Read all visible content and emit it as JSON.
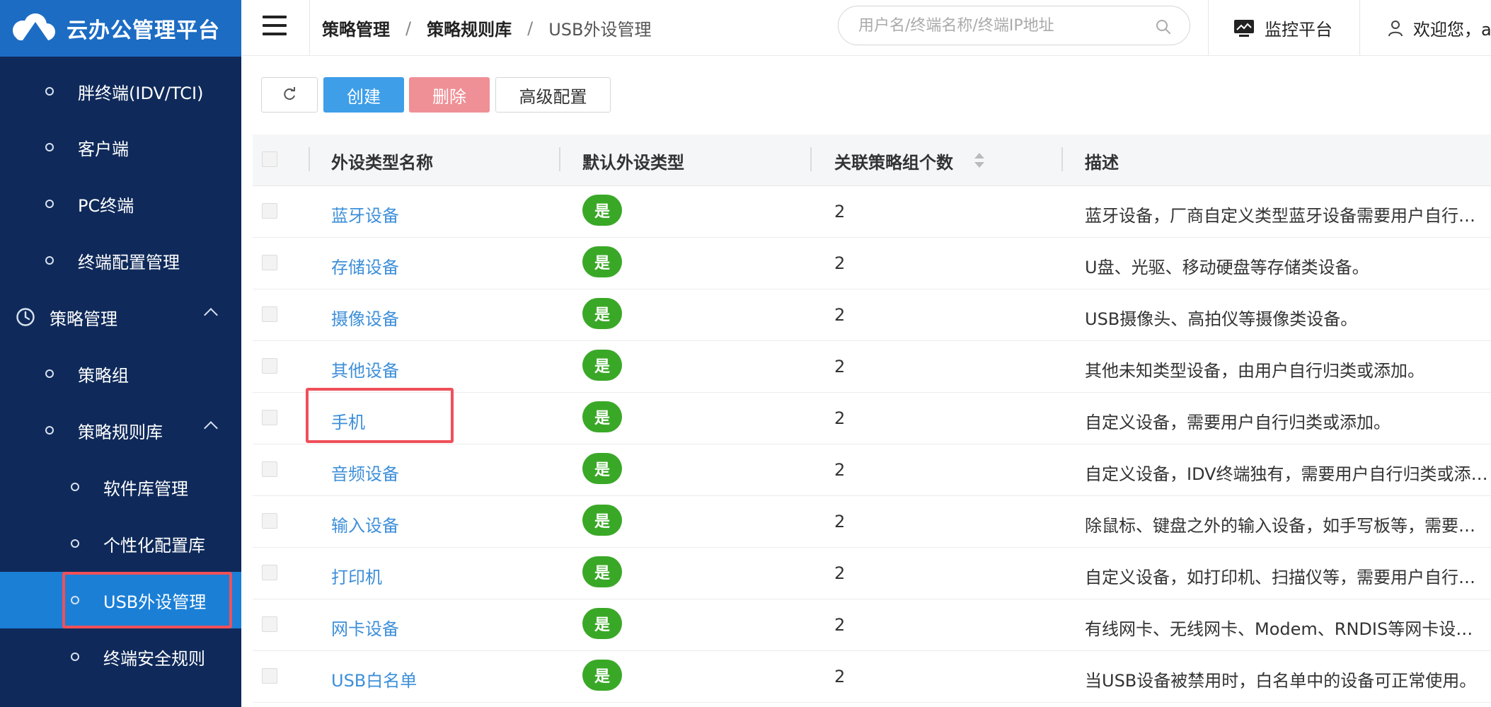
{
  "brand": {
    "name": "云办公管理平台"
  },
  "sidebar": {
    "items": [
      {
        "label": "胖终端(IDV/TCI)"
      },
      {
        "label": "客户端"
      },
      {
        "label": "PC终端"
      },
      {
        "label": "终端配置管理"
      },
      {
        "label": "策略管理"
      },
      {
        "label": "策略组"
      },
      {
        "label": "策略规则库"
      },
      {
        "label": "软件库管理"
      },
      {
        "label": "个性化配置库"
      },
      {
        "label": "USB外设管理"
      },
      {
        "label": "终端安全规则"
      }
    ]
  },
  "header": {
    "breadcrumb": [
      "策略管理",
      "策略规则库",
      "USB外设管理"
    ],
    "search_placeholder": "用户名/终端名称/终端IP地址",
    "monitor_label": "监控平台",
    "welcome_label": "欢迎您，a"
  },
  "toolbar": {
    "create_label": "创建",
    "delete_label": "删除",
    "advanced_label": "高级配置"
  },
  "table": {
    "columns": [
      "外设类型名称",
      "默认外设类型",
      "关联策略组个数",
      "描述"
    ],
    "rows": [
      {
        "name": "蓝牙设备",
        "default": "是",
        "count": "2",
        "desc": "蓝牙设备，厂商自定义类型蓝牙设备需要用户自行归类或添加。"
      },
      {
        "name": "存储设备",
        "default": "是",
        "count": "2",
        "desc": "U盘、光驱、移动硬盘等存储类设备。"
      },
      {
        "name": "摄像设备",
        "default": "是",
        "count": "2",
        "desc": "USB摄像头、高拍仪等摄像类设备。"
      },
      {
        "name": "其他设备",
        "default": "是",
        "count": "2",
        "desc": "其他未知类型设备，由用户自行归类或添加。"
      },
      {
        "name": "手机",
        "default": "是",
        "count": "2",
        "desc": "自定义设备，需要用户自行归类或添加。"
      },
      {
        "name": "音频设备",
        "default": "是",
        "count": "2",
        "desc": "自定义设备，IDV终端独有，需要用户自行归类或添加。"
      },
      {
        "name": "输入设备",
        "default": "是",
        "count": "2",
        "desc": "除鼠标、键盘之外的输入设备，如手写板等，需要用户自行归类或添加。"
      },
      {
        "name": "打印机",
        "default": "是",
        "count": "2",
        "desc": "自定义设备，如打印机、扫描仪等，需要用户自行归类或添加。"
      },
      {
        "name": "网卡设备",
        "default": "是",
        "count": "2",
        "desc": "有线网卡、无线网卡、Modem、RNDIS等网卡设备。"
      },
      {
        "name": "USB白名单",
        "default": "是",
        "count": "2",
        "desc": "当USB设备被禁用时，白名单中的设备可正常使用。"
      }
    ]
  },
  "colors": {
    "sidebar_bg": "#0f2a5a",
    "brand_bg": "#1c6cc4",
    "active_bg": "#1b7fd6",
    "primary": "#3e9ee8",
    "danger": "#ef9096",
    "success": "#3aa827",
    "link": "#3d8fd9",
    "highlight": "#f0505a"
  },
  "icons": [
    "cloud-logo-icon",
    "hamburger-menu-icon",
    "search-icon",
    "monitor-icon",
    "user-icon",
    "refresh-icon",
    "clock-icon",
    "chevron-up-icon",
    "sort-icon"
  ]
}
